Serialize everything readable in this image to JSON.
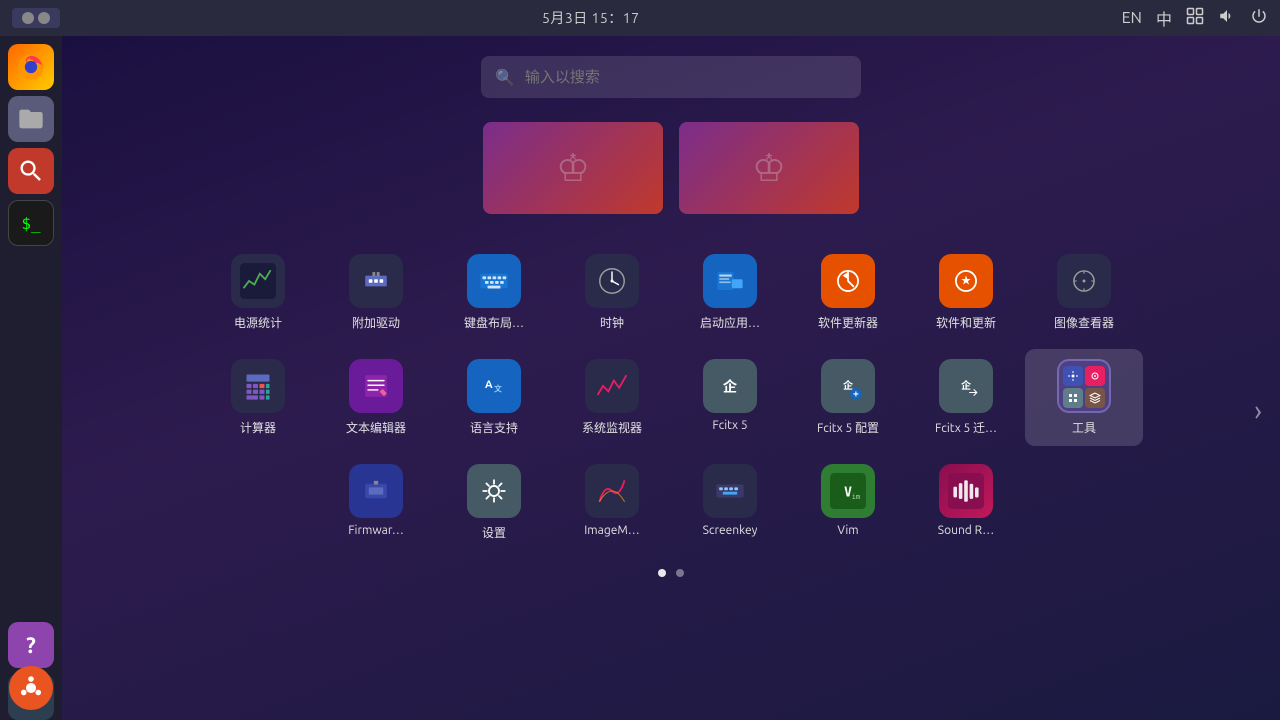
{
  "topbar": {
    "datetime": "5月3日  15：17",
    "window_control_hint": "window controls"
  },
  "topbar_icons": {
    "lang_cn": "中",
    "lang_en": "EN",
    "network": "⊞",
    "sound": "🔊",
    "power": "⏻"
  },
  "search": {
    "placeholder": "输入以搜索"
  },
  "dock": {
    "items": [
      {
        "name": "Firefox",
        "label": "firefox"
      },
      {
        "name": "Files",
        "label": "files"
      },
      {
        "name": "Software Center",
        "label": "software-center"
      },
      {
        "name": "Terminal",
        "label": "terminal"
      },
      {
        "name": "Help",
        "label": "help"
      },
      {
        "name": "Trash",
        "label": "trash"
      },
      {
        "name": "Ubuntu",
        "label": "ubuntu"
      }
    ]
  },
  "banners": [
    {
      "id": "banner1",
      "alt": "Featured app 1"
    },
    {
      "id": "banner2",
      "alt": "Featured app 2"
    }
  ],
  "app_rows": [
    {
      "row": 1,
      "apps": [
        {
          "id": "power-stats",
          "label": "电源统计",
          "icon_type": "power-stats"
        },
        {
          "id": "firmware-addon",
          "label": "附加驱动",
          "icon_type": "firmware-addon"
        },
        {
          "id": "keyboard-layout",
          "label": "键盘布局…",
          "icon_type": "keyboard-layout"
        },
        {
          "id": "clock",
          "label": "时钟",
          "icon_type": "clock"
        },
        {
          "id": "startup-apps",
          "label": "启动应用…",
          "icon_type": "startup-apps"
        },
        {
          "id": "software-updater",
          "label": "软件更新器",
          "icon_type": "software-updater"
        },
        {
          "id": "software-update2",
          "label": "软件和更新",
          "icon_type": "software-update2"
        },
        {
          "id": "image-viewer",
          "label": "图像查看器",
          "icon_type": "image-viewer"
        }
      ]
    },
    {
      "row": 2,
      "apps": [
        {
          "id": "calculator",
          "label": "计算器",
          "icon_type": "calculator"
        },
        {
          "id": "text-editor",
          "label": "文本编辑器",
          "icon_type": "text-editor"
        },
        {
          "id": "language-support",
          "label": "语言支持",
          "icon_type": "language-support"
        },
        {
          "id": "system-monitor",
          "label": "系统监视器",
          "icon_type": "system-monitor"
        },
        {
          "id": "fcitx5",
          "label": "Fcitx 5",
          "icon_type": "fcitx5"
        },
        {
          "id": "fcitx5-config",
          "label": "Fcitx 5 配置",
          "icon_type": "fcitx5-config"
        },
        {
          "id": "fcitx5-migrate",
          "label": "Fcitx 5 迁…",
          "icon_type": "fcitx5-migrate"
        },
        {
          "id": "tools-folder",
          "label": "工具",
          "icon_type": "tools-folder",
          "selected": true
        }
      ]
    },
    {
      "row": 3,
      "apps": [
        {
          "id": "firmware",
          "label": "Firmwar…",
          "icon_type": "firmware"
        },
        {
          "id": "settings",
          "label": "设置",
          "icon_type": "settings"
        },
        {
          "id": "imagemagick",
          "label": "ImageM…",
          "icon_type": "imagemagick"
        },
        {
          "id": "screenkey",
          "label": "Screenkey",
          "icon_type": "screenkey"
        },
        {
          "id": "vim",
          "label": "Vim",
          "icon_type": "vim"
        },
        {
          "id": "sound-recorder",
          "label": "Sound R…",
          "icon_type": "sound-recorder"
        }
      ]
    }
  ],
  "page_dots": [
    {
      "active": true
    },
    {
      "active": false
    }
  ],
  "chevron": "›"
}
